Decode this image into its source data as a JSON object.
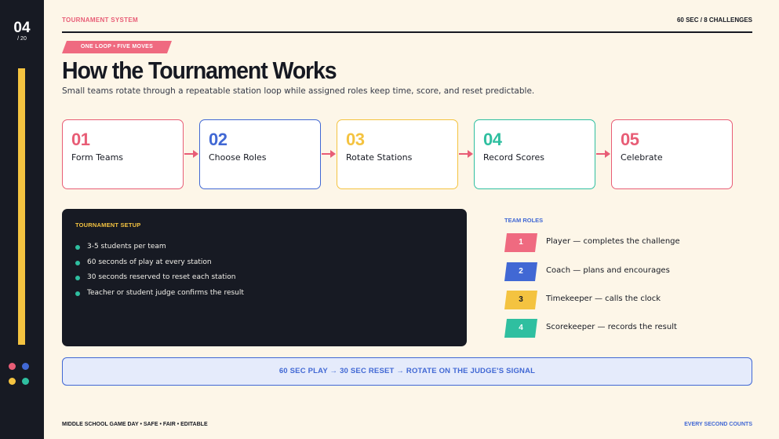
{
  "slide": {
    "number": "04",
    "total": "/ 20"
  },
  "header": {
    "section": "TOURNAMENT SYSTEM",
    "meta": "60 SEC  /  8 CHALLENGES"
  },
  "tag": "ONE LOOP • FIVE MOVES",
  "title": "How the Tournament Works",
  "subtitle": "Small teams rotate through a repeatable station loop while assigned roles keep time, score, and reset predictable.",
  "steps": [
    {
      "num": "01",
      "label": "Form Teams",
      "color": "#e85d76"
    },
    {
      "num": "02",
      "label": "Choose Roles",
      "color": "#4168d4"
    },
    {
      "num": "03",
      "label": "Rotate Stations",
      "color": "#f4c340"
    },
    {
      "num": "04",
      "label": "Record Scores",
      "color": "#2fbfa0"
    },
    {
      "num": "05",
      "label": "Celebrate",
      "color": "#e85d76"
    }
  ],
  "setup": {
    "title": "TOURNAMENT SETUP",
    "items": [
      "3-5 students per team",
      "60 seconds of play at every station",
      "30 seconds reserved to reset each station",
      "Teacher or student judge confirms the result"
    ]
  },
  "roles": {
    "title": "TEAM ROLES",
    "items": [
      {
        "num": "1",
        "text": "Player — completes the challenge",
        "color": "#ef6a80",
        "text_color": "#ffffff"
      },
      {
        "num": "2",
        "text": "Coach — plans and encourages",
        "color": "#4168d4",
        "text_color": "#ffffff"
      },
      {
        "num": "3",
        "text": "Timekeeper — calls the clock",
        "color": "#f4c340",
        "text_color": "#161922"
      },
      {
        "num": "4",
        "text": "Scorekeeper — records the result",
        "color": "#2fbfa0",
        "text_color": "#ffffff"
      }
    ]
  },
  "banner": "60 SEC PLAY  →  30 SEC RESET  →  ROTATE ON THE JUDGE'S SIGNAL",
  "footer": {
    "left": "MIDDLE SCHOOL GAME DAY  •  SAFE  •  FAIR  •  EDITABLE",
    "right": "EVERY SECOND COUNTS"
  },
  "colors": {
    "accent_red": "#e85d76",
    "accent_blue": "#4168d4",
    "accent_yellow": "#f4c340",
    "accent_teal": "#2fbfa0",
    "dark": "#171a23",
    "background": "#fdf6e8"
  }
}
